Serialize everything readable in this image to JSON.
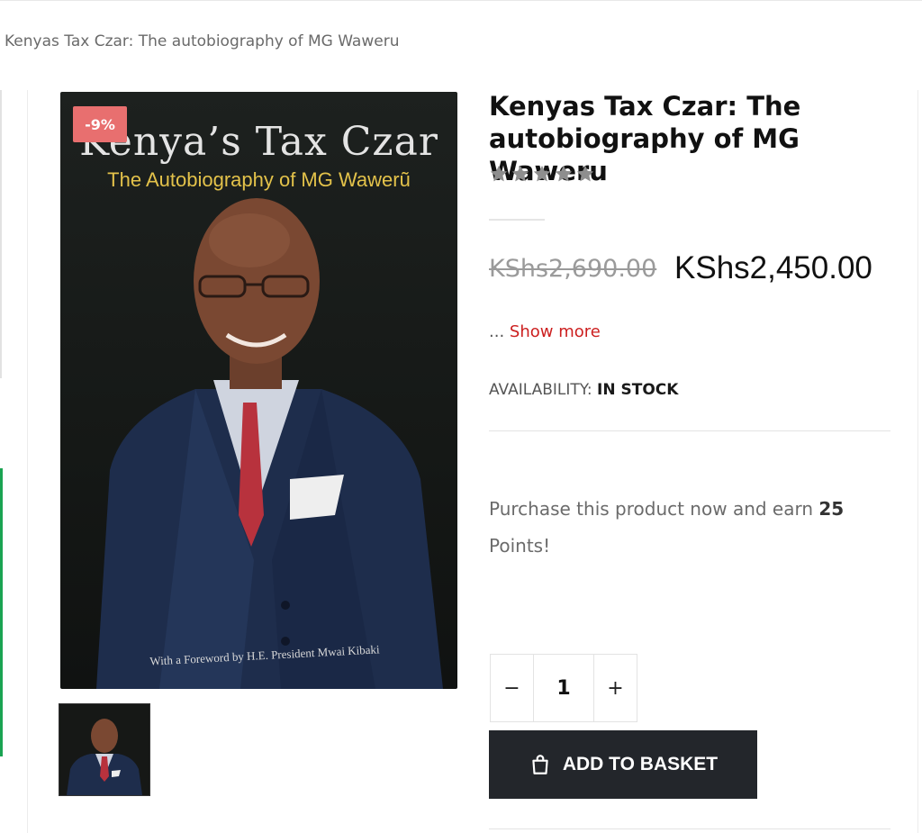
{
  "breadcrumb": "Kenyas Tax Czar: The autobiography of MG Waweru",
  "product": {
    "discount_badge": "-9%",
    "title": "Kenyas Tax Czar: The autobiography of MG Waweru",
    "rating_stars": 0,
    "old_price": "KShs2,690.00",
    "new_price": "KShs2,450.00",
    "show_more_prefix": "...",
    "show_more_label": "Show more",
    "availability_label": "AVAILABILITY:",
    "availability_value": "IN STOCK",
    "points_text": "Purchase this product now and earn",
    "points_value": "25",
    "points_suffix": "Points!",
    "quantity": "1",
    "qty_minus": "−",
    "qty_plus": "+",
    "add_to_basket": "ADD TO BASKET"
  },
  "cover": {
    "title": "Kenya’s Tax Czar",
    "subtitle": "The Autobiography of MG Wawerũ",
    "foreword": "With a Foreword by H.E. President Mwai Kibaki"
  },
  "colors": {
    "badge": "#e86f6f",
    "show_more": "#cc1f1f",
    "button": "#23262b",
    "accent_green": "#1aa352"
  }
}
